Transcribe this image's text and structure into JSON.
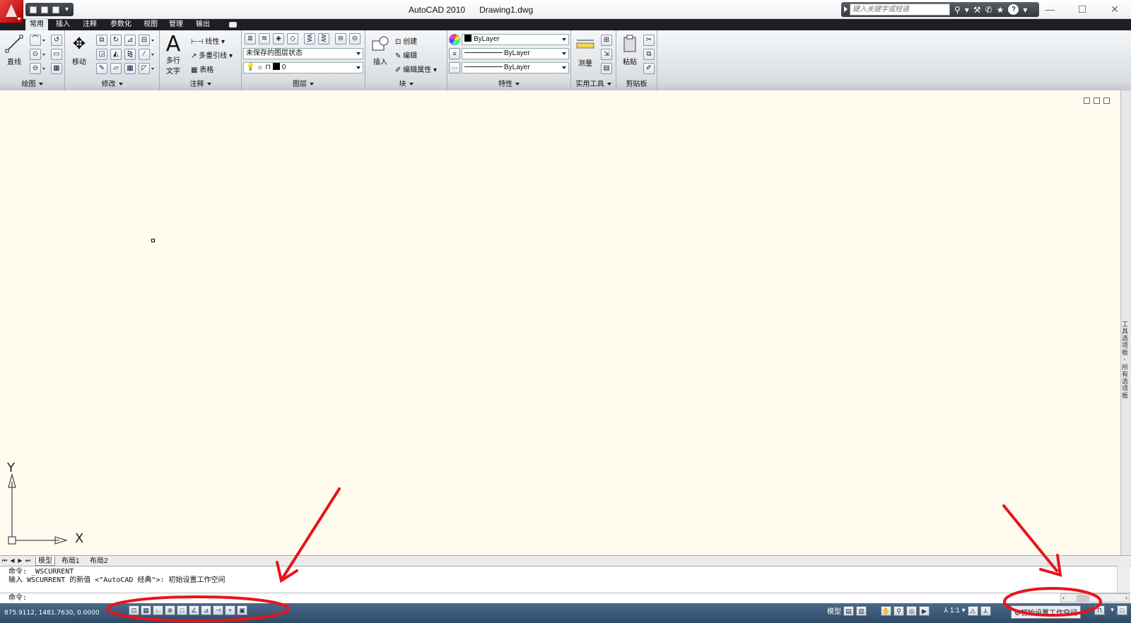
{
  "window": {
    "app_name": "AutoCAD 2010",
    "document": "Drawing1.dwg",
    "minimize": "—",
    "maximize": "☐",
    "close": "✕"
  },
  "search": {
    "placeholder": "键入关键字或短语"
  },
  "ribbon_tabs": [
    {
      "label": "常用",
      "active": true
    },
    {
      "label": "插入"
    },
    {
      "label": "注释"
    },
    {
      "label": "参数化"
    },
    {
      "label": "视图"
    },
    {
      "label": "管理"
    },
    {
      "label": "输出"
    }
  ],
  "panels": {
    "draw": {
      "title": "绘图",
      "line_label": "直线"
    },
    "modify": {
      "title": "修改",
      "move_label": "移动"
    },
    "annotation": {
      "title": "注释",
      "mtext_label_1": "多行",
      "mtext_label_2": "文字",
      "linear_label": "线性",
      "mleader_label": "多重引线",
      "table_label": "表格"
    },
    "layers": {
      "title": "图层",
      "layer_state": "未保存的图层状态",
      "current_layer": "0"
    },
    "block": {
      "title": "块",
      "insert_label": "插入",
      "create_label": "创建",
      "edit_label": "编辑",
      "edit_attr_label": "编辑属性"
    },
    "properties": {
      "title": "特性",
      "color": "ByLayer",
      "linetype": "ByLayer",
      "lineweight": "ByLayer"
    },
    "utilities": {
      "title": "实用工具",
      "measure_label": "测量"
    },
    "clipboard": {
      "title": "剪贴板",
      "paste_label": "粘贴"
    }
  },
  "palette_label": "工具选项板 - 所有选项板",
  "ucs": {
    "x_label": "X",
    "y_label": "Y"
  },
  "layout_tabs": [
    {
      "label": "模型",
      "active": true
    },
    {
      "label": "布局1"
    },
    {
      "label": "布局2"
    }
  ],
  "command": {
    "history_line_1": "命令: _WSCURRENT",
    "history_line_2": "输入 WSCURRENT 的新值 <\"AutoCAD 经典\">: 初始设置工作空间",
    "prompt": "命令:"
  },
  "status": {
    "coordinates": "875.9112,  1481.7630,  0.0000",
    "model_label": "模型",
    "scale_label": "1:1",
    "workspace_label": "初始设置工作空间"
  },
  "colors": {
    "drawing_background": "#fffbef",
    "annotation_red": "#e8141b",
    "status_bar": "#3b5a7a"
  }
}
